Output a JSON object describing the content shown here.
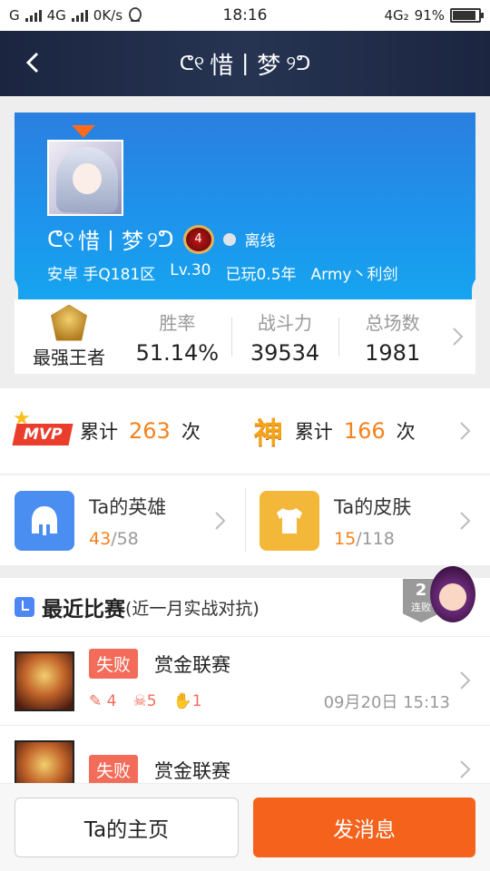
{
  "status_bar": {
    "carrier": "G",
    "network": "4G",
    "speed": "0K/s",
    "time": "18:16",
    "network_right": "4G₂",
    "battery": "91%",
    "battery_level": 0.91
  },
  "header": {
    "title": "惜丨梦"
  },
  "profile": {
    "name": "惜丨梦",
    "rank_level": "4",
    "status": "离线",
    "platform": "安卓 手Q181区",
    "level": "Lv.30",
    "played": "已玩0.5年",
    "guild": "Army丶利剑"
  },
  "stats": {
    "rank_name": "最强王者",
    "items": [
      {
        "label": "胜率",
        "value": "51.14%"
      },
      {
        "label": "战斗力",
        "value": "39534"
      },
      {
        "label": "总场数",
        "value": "1981"
      }
    ]
  },
  "awards": {
    "mvp_badge": "MVP",
    "mvp_prefix": "累计",
    "mvp_count": "263",
    "mvp_unit": "次",
    "god_badge": "神",
    "god_prefix": "累计",
    "god_count": "166",
    "god_unit": "次"
  },
  "tiles": {
    "heroes": {
      "title": "Ta的英雄",
      "owned": "43",
      "sep": "/",
      "total": "58"
    },
    "skins": {
      "title": "Ta的皮肤",
      "owned": "15",
      "sep": "/",
      "total": "118"
    }
  },
  "recent": {
    "title": "最近比赛",
    "subtitle": "(近一月实战对抗)",
    "streak_count": "2",
    "streak_label": "连败",
    "matches": [
      {
        "result": "失败",
        "mode": "赏金联赛",
        "kills": "4",
        "deaths": "5",
        "assists": "1",
        "time": "09月20日 15:13"
      },
      {
        "result": "失败",
        "mode": "赏金联赛",
        "kills": "",
        "deaths": "",
        "assists": "",
        "time": ""
      }
    ]
  },
  "buttons": {
    "home": "Ta的主页",
    "message": "发消息"
  },
  "colors": {
    "accent_orange": "#f4621b",
    "profile_blue": "#1d95ec",
    "loss_red": "#f36c5a"
  }
}
